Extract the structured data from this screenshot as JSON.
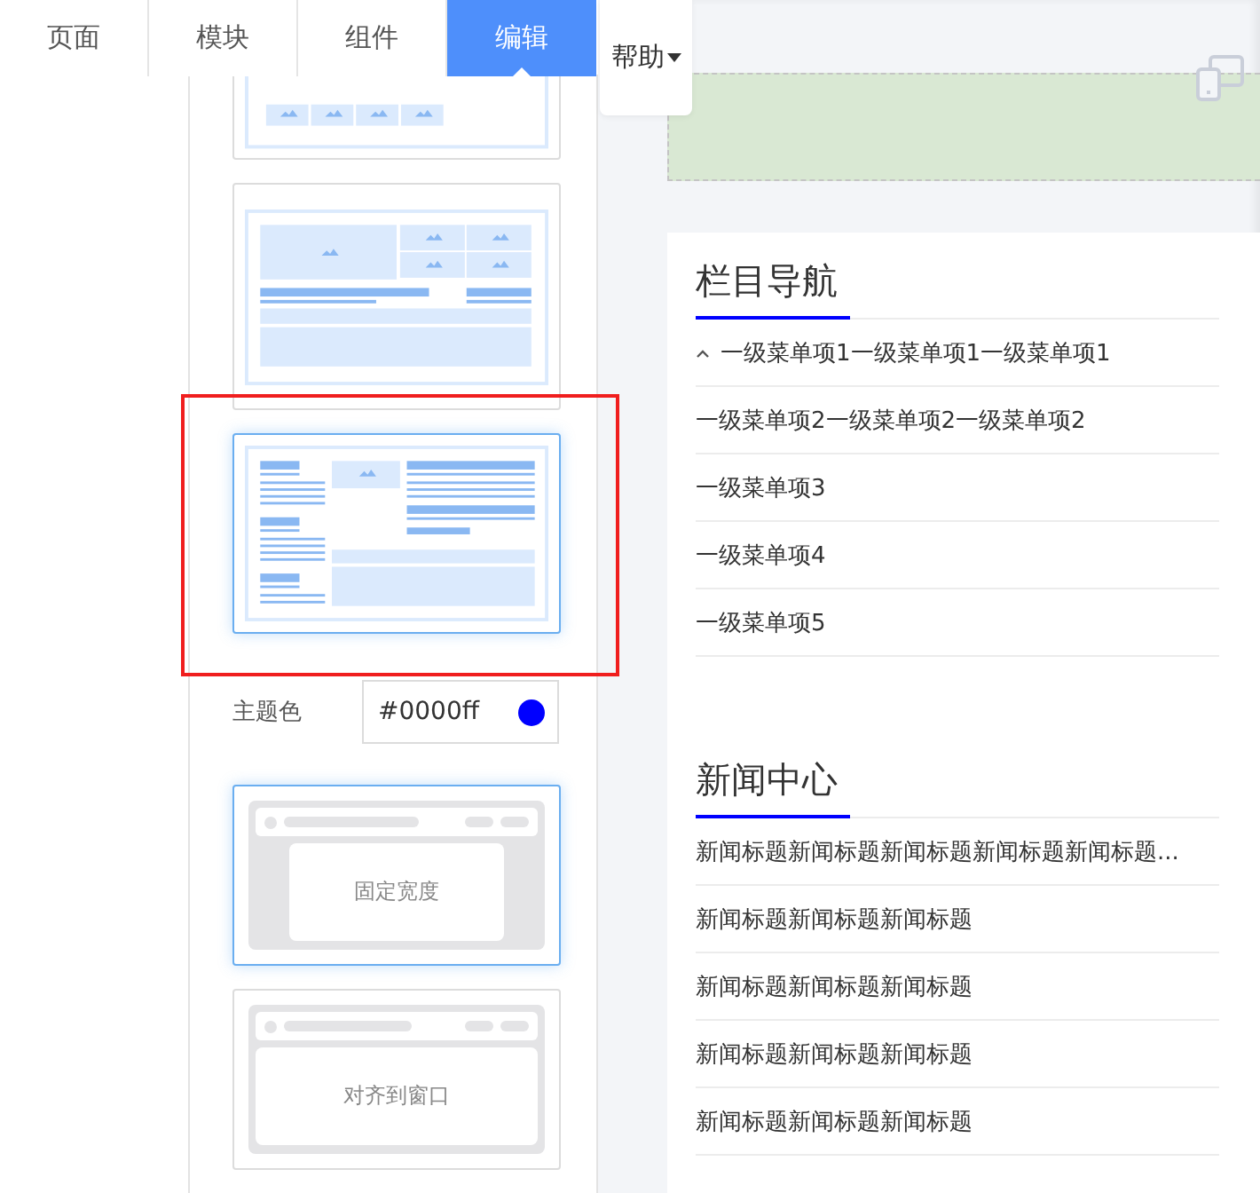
{
  "tabs": [
    {
      "label": "页面",
      "selected": false
    },
    {
      "label": "模块",
      "selected": false
    },
    {
      "label": "组件",
      "selected": false
    },
    {
      "label": "编辑",
      "selected": true
    }
  ],
  "help_menu": {
    "label": "帮助"
  },
  "layout_templates": [
    {
      "kind": "grid",
      "selected": false
    },
    {
      "kind": "hero",
      "selected": false
    },
    {
      "kind": "columns",
      "selected": true
    }
  ],
  "theme_color": {
    "label": "主题色",
    "value": "#0000ff",
    "color": "#0000ff"
  },
  "width_options": [
    {
      "kind": "fixed",
      "label": "固定宽度",
      "selected": true
    },
    {
      "kind": "fluid",
      "label": "对齐到窗口",
      "selected": false
    }
  ],
  "nav_section": {
    "title": "栏目导航",
    "items": [
      {
        "kind": "group",
        "label": "一级菜单项1一级菜单项1一级菜单项1"
      },
      {
        "kind": "item",
        "label": "一级菜单项2一级菜单项2一级菜单项2"
      },
      {
        "kind": "item",
        "label": "一级菜单项3"
      },
      {
        "kind": "item",
        "label": "一级菜单项4"
      },
      {
        "kind": "item",
        "label": "一级菜单项5"
      }
    ]
  },
  "news_section": {
    "title": "新闻中心",
    "items": [
      "新闻标题新闻标题新闻标题新闻标题新闻标题...",
      "新闻标题新闻标题新闻标题",
      "新闻标题新闻标题新闻标题",
      "新闻标题新闻标题新闻标题",
      "新闻标题新闻标题新闻标题"
    ]
  }
}
